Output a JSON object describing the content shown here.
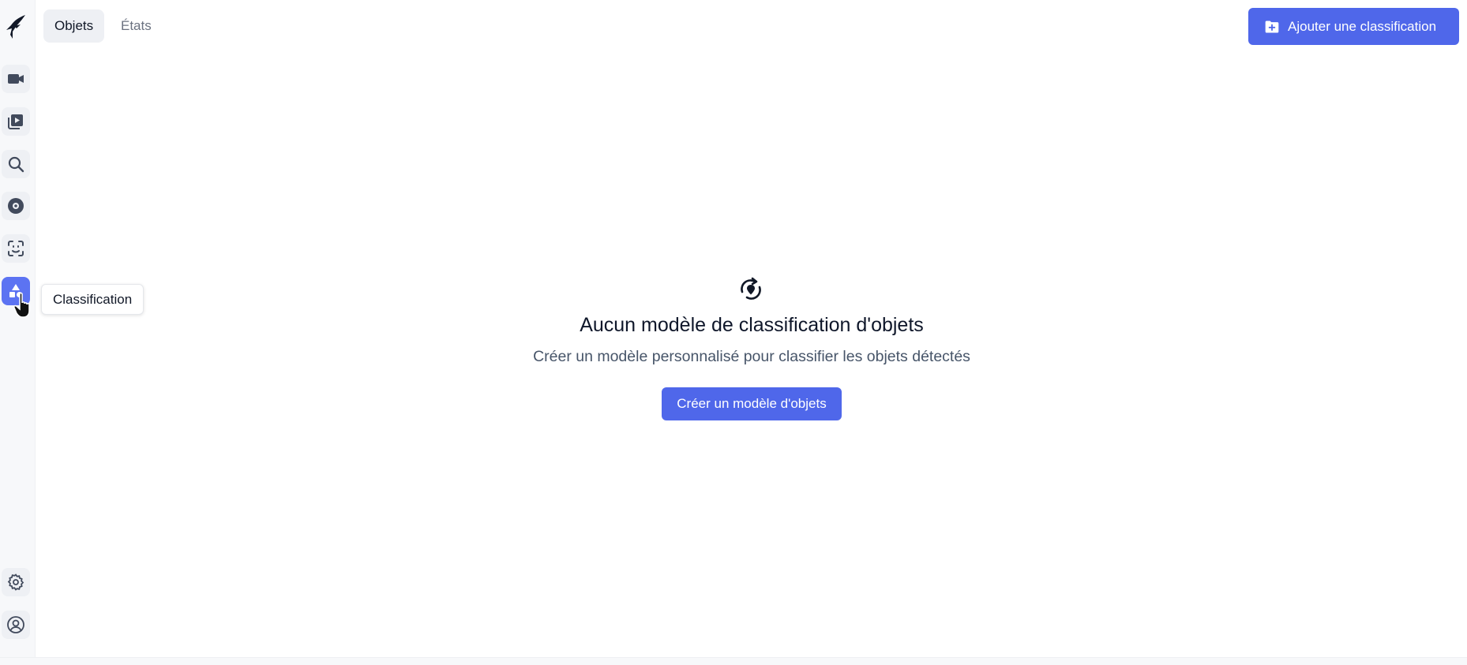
{
  "tabs": [
    {
      "label": "Objets",
      "active": true
    },
    {
      "label": "États",
      "active": false
    }
  ],
  "actions": {
    "add_label": "Ajouter une classification"
  },
  "sidebar": {
    "items": [
      {
        "name": "live-cameras",
        "icon": "video-camera-icon"
      },
      {
        "name": "recordings",
        "icon": "play-library-icon"
      },
      {
        "name": "explore",
        "icon": "search-icon"
      },
      {
        "name": "review",
        "icon": "disc-icon"
      },
      {
        "name": "face-recognition",
        "icon": "face-scan-icon"
      },
      {
        "name": "classification",
        "icon": "shapes-icon",
        "active": true
      }
    ],
    "bottom": [
      {
        "name": "settings",
        "icon": "gear-icon"
      },
      {
        "name": "account",
        "icon": "user-circle-icon"
      }
    ],
    "tooltip": "Classification"
  },
  "empty_state": {
    "icon": "rotate-pin-icon",
    "title": "Aucun modèle de classification d'objets",
    "subtitle": "Créer un modèle personnalisé pour classifier les objets détectés",
    "button_label": "Créer un modèle d'objets"
  },
  "colors": {
    "accent": "#4f67ea",
    "active_nav": "#5c73f2"
  }
}
